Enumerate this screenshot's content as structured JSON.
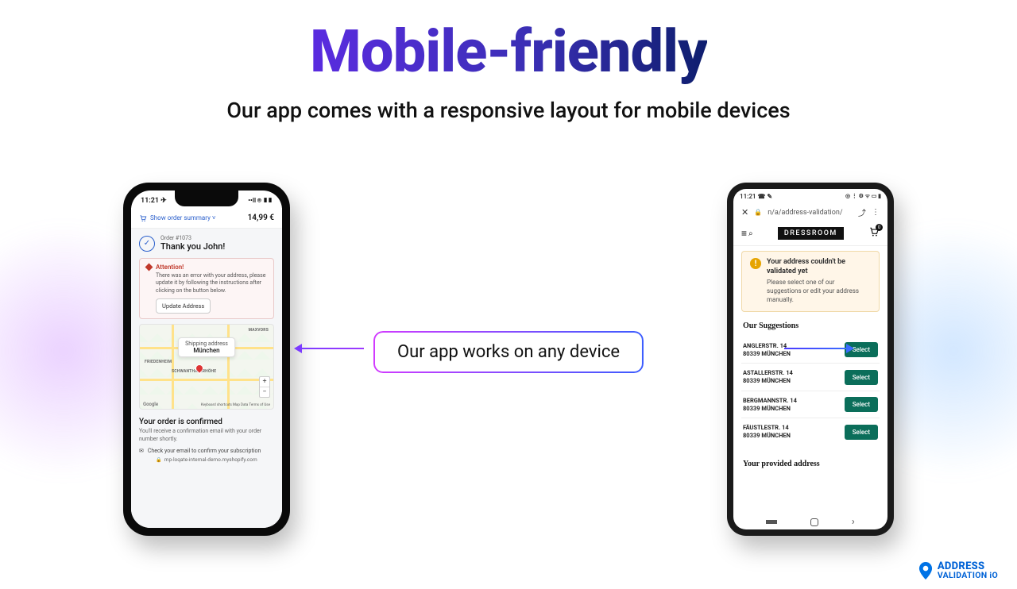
{
  "headline": "Mobile-friendly",
  "subhead": "Our app comes with a responsive layout for mobile devices",
  "callout": "Our app works on any device",
  "iphone": {
    "status_time": "11:21 ✈",
    "status_icons": "••ll ⌾ ▮▮",
    "summary_link": "Show order summary ˅",
    "summary_price": "14,99 €",
    "order_no": "Order #1073",
    "thank": "Thank you John!",
    "alert_title": "Attention!",
    "alert_body": "There was an error with your address, please update it by following the instructions after clicking on the button below.",
    "update_btn": "Update Address",
    "map_bubble_label": "Shipping address",
    "map_bubble_value": "München",
    "map_labels": {
      "a": "MAXVORS",
      "b": "FRIEDENHEIM",
      "c": "SCHWANTHALERHÖHE"
    },
    "map_google": "Google",
    "map_footer": "Keyboard shortcuts    Map Data    Terms of Use",
    "confirm_title": "Your order is confirmed",
    "confirm_body": "You'll receive a confirmation email with your order number shortly.",
    "sub_line": "Check your email to confirm your subscription",
    "sub_icon": "✉",
    "domain": "mp-loqate-internal-demo.myshopify.com"
  },
  "android": {
    "status_time": "11:21 ☎ ✎",
    "url": "n/a/address-validation/",
    "brand": "DRESSROOM",
    "cart_badge": "0",
    "warn_title": "Your address couldn't be validated yet",
    "warn_body": "Please select one of our suggestions or edit your address manually.",
    "suggestions_title": "Our Suggestions",
    "suggestions": [
      {
        "street": "ANGLERSTR. 14",
        "city": "80339 MÜNCHEN"
      },
      {
        "street": "ASTALLERSTR. 14",
        "city": "80339 MÜNCHEN"
      },
      {
        "street": "BERGMANNSTR. 14",
        "city": "80339 MÜNCHEN"
      },
      {
        "street": "FÄUSTLESTR. 14",
        "city": "80339 MÜNCHEN"
      }
    ],
    "select_label": "Select",
    "provided_title": "Your provided address"
  },
  "brand_corner": {
    "line1": "ADDRESS",
    "line2": "VALIDATION iO"
  }
}
